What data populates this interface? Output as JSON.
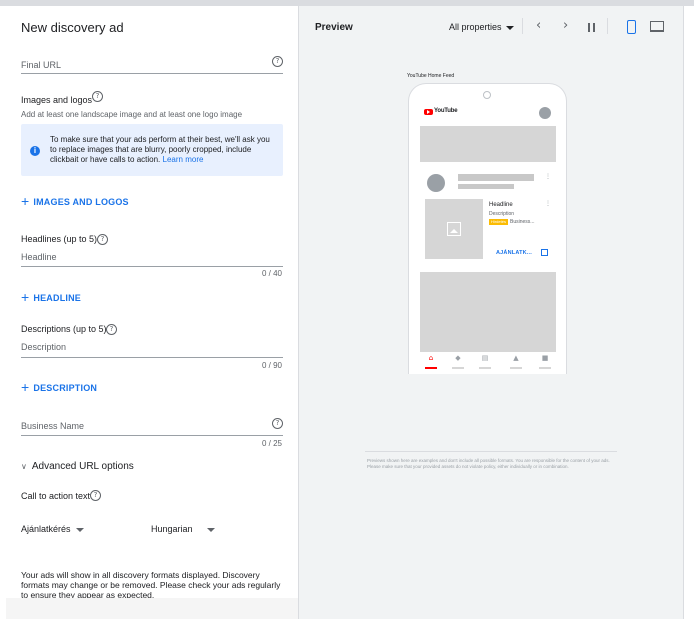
{
  "form": {
    "title": "New discovery ad",
    "final_url": {
      "placeholder": "Final URL"
    },
    "images": {
      "label": "Images and logos",
      "hint": "Add at least one landscape image and at least one logo image",
      "info_text": "To make sure that your ads perform at their best, we'll ask you to replace images that are blurry, poorly cropped, include clickbait or have calls to action.",
      "info_link": "Learn more",
      "add_button": "IMAGES AND LOGOS"
    },
    "headlines": {
      "label": "Headlines (up to 5)",
      "placeholder": "Headline",
      "counter": "0 / 40",
      "add_button": "HEADLINE"
    },
    "descriptions": {
      "label": "Descriptions (up to 5)",
      "placeholder": "Description",
      "counter": "0 / 90",
      "add_button": "DESCRIPTION"
    },
    "business_name": {
      "placeholder": "Business Name",
      "counter": "0 / 25"
    },
    "advanced_url": "Advanced URL options",
    "cta": {
      "label": "Call to action text",
      "selected": "Ajánlatkérés",
      "language": "Hungarian"
    },
    "footer": "Your ads will show in all discovery formats displayed. Discovery formats may change or be removed. Please check your ads regularly to ensure they appear as expected.",
    "add_icon": "plus-icon",
    "help_icon": "help-circle-icon"
  },
  "preview": {
    "title": "Preview",
    "properties": "All properties",
    "feed_label": "YouTube Home Feed",
    "ad": {
      "brand": "YouTube",
      "headline": "Headline",
      "description": "Description",
      "badge": "Hirdetés",
      "business": "Business...",
      "cta": "AJÁNLATK..."
    },
    "disclaimer": "Previews shown here are examples and don't include all possible formats. You are responsible for the content of your ads. Please make sure that your provided assets do not violate policy, either individually or in combination.",
    "colors": {
      "accent": "#1a73e8",
      "badge": "#fbbc04",
      "youtube_red": "#ff0000"
    }
  }
}
